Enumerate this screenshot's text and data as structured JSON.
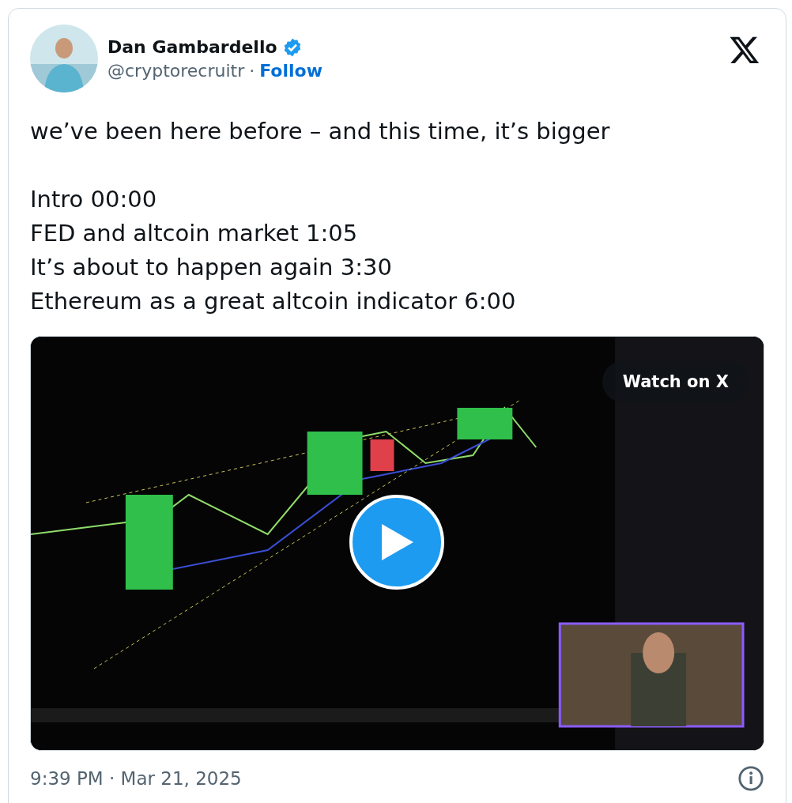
{
  "author": {
    "name": "Dan Gambardello",
    "verified": true,
    "handle": "@cryptorecruitr",
    "separator": "·",
    "follow": "Follow"
  },
  "text": {
    "headline": "we’ve been here before – and this time, it’s bigger",
    "chapters": [
      "Intro 00:00",
      "FED and altcoin market 1:05",
      "It’s about to happen again 3:30",
      "Ethereum as a great altcoin indicator 6:00"
    ]
  },
  "video": {
    "kind": "picture",
    "watch_label": "Watch on X"
  },
  "footer": {
    "timestamp": "9:39 PM · Mar 21, 2025"
  }
}
